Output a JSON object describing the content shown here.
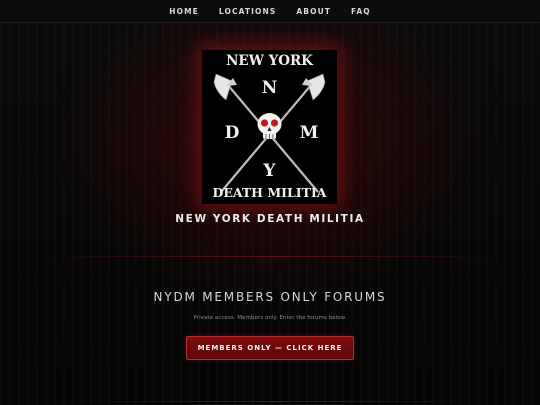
{
  "nav": {
    "items": [
      {
        "label": "HOME"
      },
      {
        "label": "LOCATIONS"
      },
      {
        "label": "ABOUT"
      },
      {
        "label": "FAQ"
      }
    ]
  },
  "logo": {
    "top_text": "NEW YORK",
    "letters": {
      "n": "N",
      "d": "D",
      "m": "M",
      "y": "Y"
    },
    "bottom_text": "DEATH MILITIA",
    "accent_color": "#c21a1a"
  },
  "hero": {
    "title": "NEW YORK DEATH MILITIA"
  },
  "forums": {
    "heading": "NYDM MEMBERS ONLY FORUMS",
    "subtext": "Private access. Members only. Enter the forums below.",
    "button_label": "MEMBERS ONLY — CLICK HERE"
  },
  "colors": {
    "background": "#060606",
    "button_bg": "#6e0a0a",
    "button_border": "#b23030",
    "glow": "#a01414"
  }
}
